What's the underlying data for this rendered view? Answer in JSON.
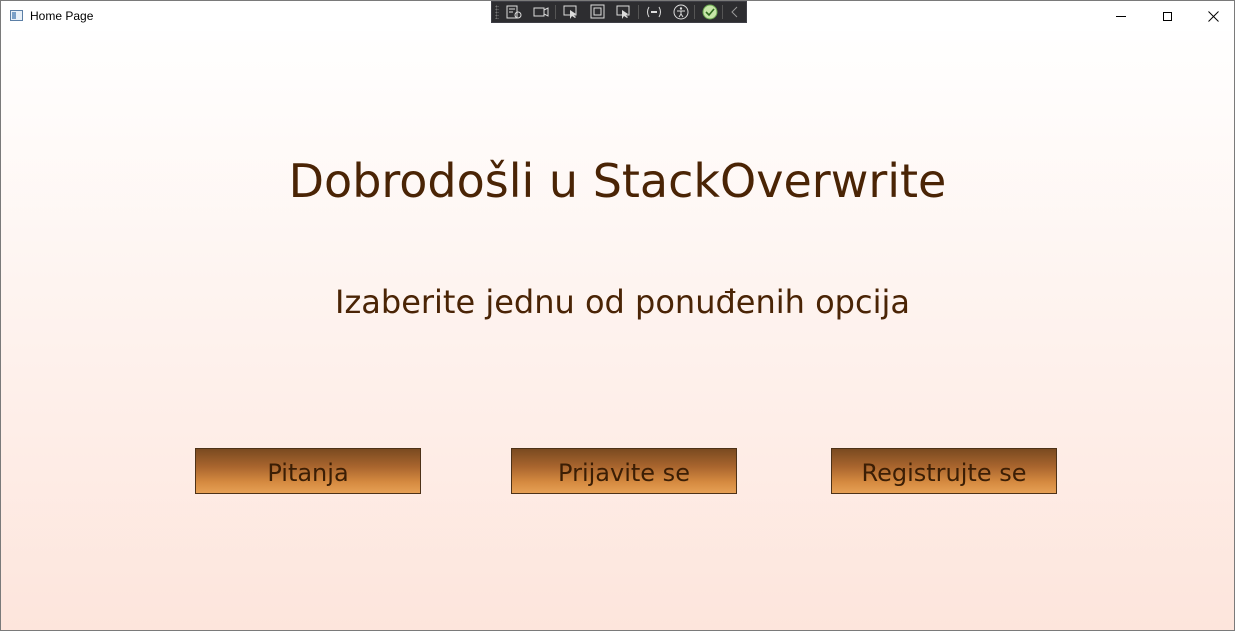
{
  "window": {
    "title": "Home Page"
  },
  "debug_toolbar": {
    "icons": [
      "live-visual-tree-icon",
      "record-icon",
      "select-element-icon",
      "display-layout-adorners-icon",
      "track-focus-icon",
      "binding-failures-icon",
      "accessibility-icon",
      "checkmark-icon",
      "collapse-chevron-icon"
    ]
  },
  "main": {
    "heading": "Dobrodošli u StackOverwrite",
    "subheading": "Izaberite jednu od ponuđenih opcija",
    "buttons": {
      "questions": "Pitanja",
      "login": "Prijavite se",
      "register": "Registrujte se"
    }
  },
  "colors": {
    "text": "#4a2405",
    "button_top": "#7a4a20",
    "button_bottom": "#e6a055",
    "background_bottom": "#fde5dc"
  }
}
